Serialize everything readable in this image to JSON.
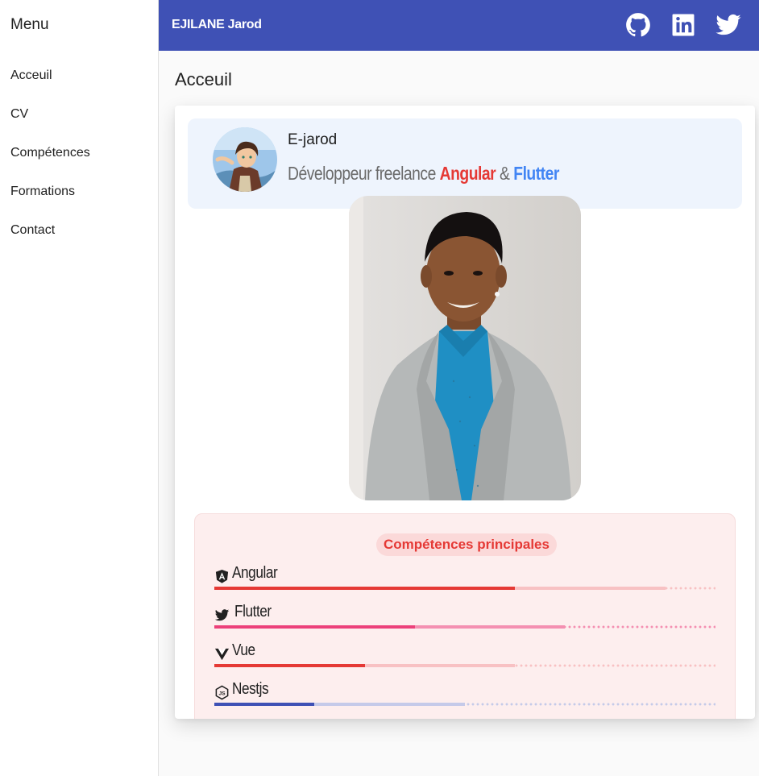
{
  "sidenav": {
    "title": "Menu",
    "items": [
      {
        "label": "Acceuil"
      },
      {
        "label": "CV"
      },
      {
        "label": "Compétences"
      },
      {
        "label": "Formations"
      },
      {
        "label": "Contact"
      }
    ]
  },
  "toolbar": {
    "title": "EJILANE Jarod",
    "social_icons": [
      "github-icon",
      "linkedin-icon",
      "twitter-icon"
    ],
    "color": "#3f51b5"
  },
  "page": {
    "title": "Acceuil"
  },
  "profile": {
    "handle": "E-jarod",
    "tagline_prefix": "Développeur freelance ",
    "tech1": "Angular",
    "separator": " & ",
    "tech2": "Flutter"
  },
  "skills": {
    "title": "Compétences principales",
    "items": [
      {
        "name": "Angular",
        "icon": "angular-icon",
        "value": 60,
        "buffer": 90,
        "color": "#e53935",
        "buffer_color": "#f8c1c3"
      },
      {
        "name": "Flutter",
        "icon": "flutter-icon",
        "value": 40,
        "buffer": 70,
        "color": "#ec407a",
        "buffer_color": "#f48fb1"
      },
      {
        "name": "Vue",
        "icon": "vue-icon",
        "value": 30,
        "buffer": 60,
        "color": "#e53935",
        "buffer_color": "#f8c1c3"
      },
      {
        "name": "Nestjs",
        "icon": "nestjs-icon",
        "value": 20,
        "buffer": 50,
        "color": "#3f51b5",
        "buffer_color": "#c5cae9"
      }
    ]
  }
}
